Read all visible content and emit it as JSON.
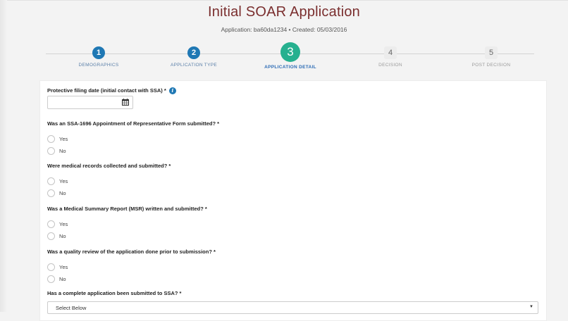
{
  "page": {
    "title": "Initial SOAR Application",
    "subtitle": "Application: ba60da1234 • Created: 05/03/2016"
  },
  "steps": [
    {
      "number": "1",
      "label": "DEMOGRAPHICS",
      "state": "done"
    },
    {
      "number": "2",
      "label": "APPLICATION TYPE",
      "state": "done"
    },
    {
      "number": "3",
      "label": "APPLICATION DETAIL",
      "state": "active"
    },
    {
      "number": "4",
      "label": "DECISION",
      "state": "todo"
    },
    {
      "number": "5",
      "label": "POST DECISION",
      "state": "todo"
    }
  ],
  "form": {
    "protective_filing": {
      "label": "Protective filing date (initial contact with SSA) *",
      "value": "",
      "info_icon": "info-circle-icon",
      "calendar_icon": "calendar-icon"
    },
    "questions": [
      {
        "label": "Was an SSA-1696 Appointment of Representative Form submitted? *",
        "options": [
          "Yes",
          "No"
        ]
      },
      {
        "label": "Were medical records collected and submitted? *",
        "options": [
          "Yes",
          "No"
        ]
      },
      {
        "label": "Was a Medical Summary Report (MSR) written and submitted? *",
        "options": [
          "Yes",
          "No"
        ]
      },
      {
        "label": "Was a quality review of the application done prior to submission? *",
        "options": [
          "Yes",
          "No"
        ]
      }
    ],
    "submitted": {
      "label": "Has a complete application been submitted to SSA? *",
      "selected": "Select Below",
      "caret": "▼"
    }
  },
  "colors": {
    "title": "#7a2e2e",
    "step_done": "#1f78b4",
    "step_active": "#26b08f"
  }
}
